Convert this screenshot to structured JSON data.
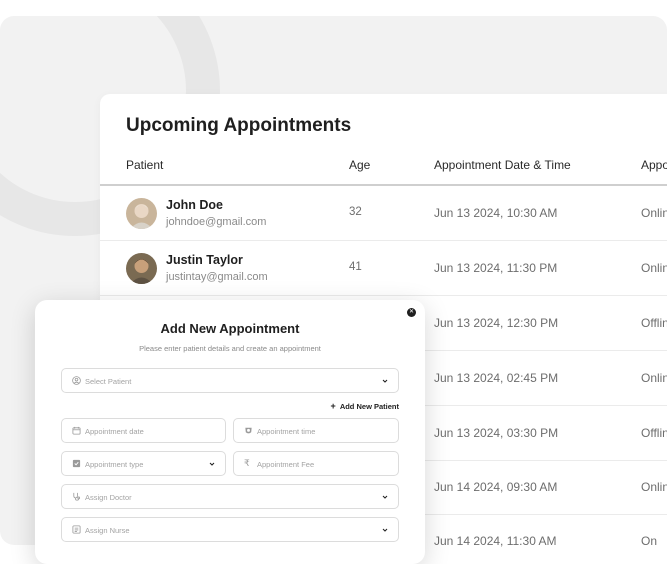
{
  "table": {
    "title": "Upcoming Appointments",
    "headers": [
      "Patient",
      "Age",
      "Appointment Date & Time",
      "Appo"
    ],
    "rows": [
      {
        "name": "John Doe",
        "email": "johndoe@gmail.com",
        "age": "32",
        "datetime": "Jun 13 2024, 10:30 AM",
        "type": "Onlin"
      },
      {
        "name": "Justin Taylor",
        "email": "justintay@gmail.com",
        "age": "41",
        "datetime": "Jun 13 2024, 11:30 PM",
        "type": "Onlin"
      },
      {
        "name": "",
        "email": "",
        "age": "",
        "datetime": "Jun 13 2024, 12:30 PM",
        "type": "Offlin"
      },
      {
        "name": "",
        "email": "",
        "age": "",
        "datetime": "Jun 13 2024, 02:45 PM",
        "type": "Onlin"
      },
      {
        "name": "",
        "email": "",
        "age": "",
        "datetime": "Jun 13 2024, 03:30 PM",
        "type": "Offlin"
      },
      {
        "name": "",
        "email": "",
        "age": "",
        "datetime": "Jun 14 2024, 09:30 AM",
        "type": "Onlin"
      },
      {
        "name": "",
        "email": "",
        "age": "",
        "datetime": "Jun 14 2024, 11:30 AM",
        "type": "On"
      }
    ]
  },
  "modal": {
    "title": "Add New Appointment",
    "subtitle": "Please enter patient details and create an appointment",
    "close_icon": "close-icon",
    "select_patient": "Select Patient",
    "add_new_patient": "Add New Patient",
    "appointment_date": "Appointment date",
    "appointment_time": "Appointment time",
    "appointment_type": "Appointment type",
    "appointment_fee": "Appointment Fee",
    "assign_doctor": "Assign Doctor",
    "assign_nurse": "Assign Nurse"
  },
  "colors": {
    "background": "#f2f2f2",
    "card": "#ffffff",
    "text_primary": "#1f1f1f",
    "text_muted": "#8a8a8a",
    "border": "#dcdcdc"
  }
}
